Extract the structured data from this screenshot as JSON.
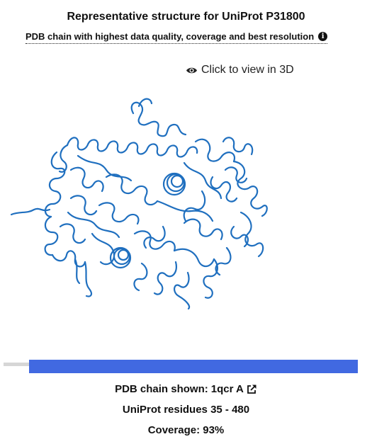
{
  "title": "Representative structure for UniProt P31800",
  "subtitle": "PDB chain with highest data quality, coverage and best resolution",
  "info_icon": "info-icon",
  "view3d": {
    "label": "Click to view in 3D",
    "icon": "eye-icon"
  },
  "structure_image": {
    "color": "#1f6fbf",
    "description_icon": "protein-ribbon"
  },
  "coverage_bar": {
    "fill_color": "#4169e1",
    "track_color": "#d6d6d6",
    "start_fraction": 0.072,
    "end_fraction": 1.0
  },
  "pdb_chain": {
    "label": "PDB chain shown:",
    "value": "1qcr A",
    "link_icon": "external-link-icon"
  },
  "residues": "UniProt residues 35 - 480",
  "coverage": "Coverage: 93%"
}
